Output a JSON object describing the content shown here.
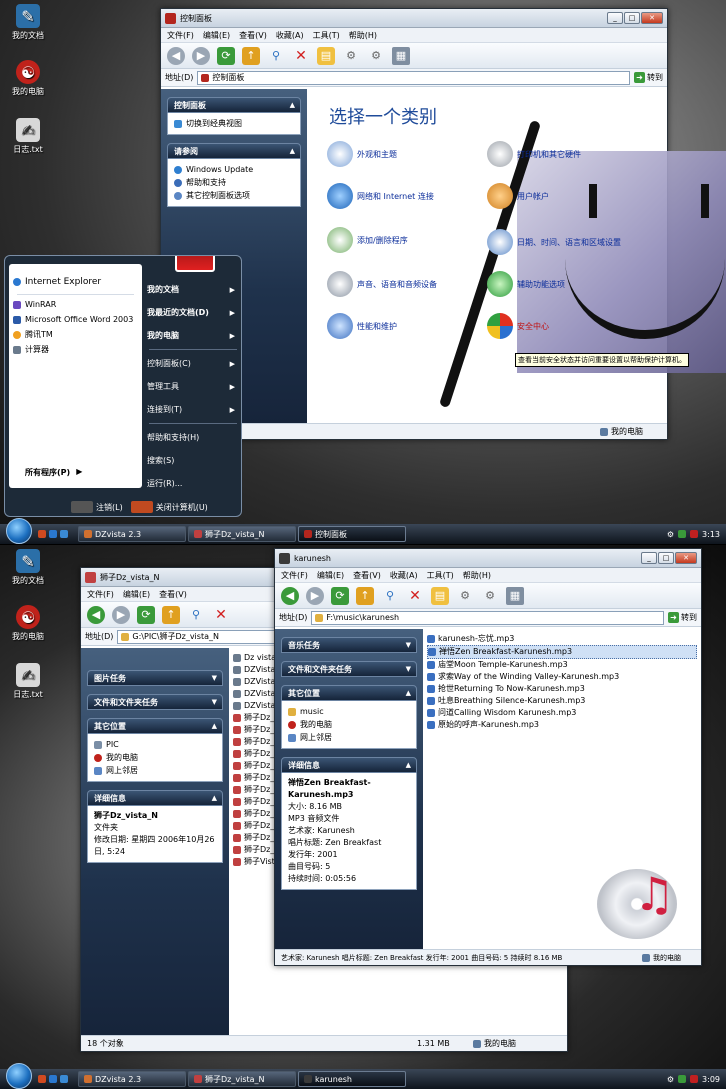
{
  "desktop_icons": [
    "我的文档",
    "我的电脑",
    "日志.txt"
  ],
  "control_panel": {
    "title": "控制面板",
    "menu": [
      "文件(F)",
      "编辑(E)",
      "查看(V)",
      "收藏(A)",
      "工具(T)",
      "帮助(H)"
    ],
    "address_label": "地址(D)",
    "address": "控制面板",
    "go": "转到",
    "side_panel_title": "控制面板",
    "switch_view": "切换到经典视图",
    "see_also_title": "请参阅",
    "see_also": [
      "Windows Update",
      "帮助和支持",
      "其它控制面板选项"
    ],
    "heading": "选择一个类别",
    "categories": [
      "外观和主题",
      "打印机和其它硬件",
      "网络和 Internet 连接",
      "用户帐户",
      "添加/删除程序",
      "日期、时间、语言和区域设置",
      "声音、语音和音频设备",
      "辅助功能选项",
      "性能和维护",
      "安全中心"
    ],
    "tooltip": "查看当前安全状态并访问重要设置以帮助保护计算机。",
    "status": "我的电脑"
  },
  "start_menu": {
    "pinned": [
      "Internet Explorer",
      "WinRAR",
      "Microsoft Office Word 2003",
      "腾讯TM",
      "计算器"
    ],
    "all_programs": "所有程序(P)",
    "right": [
      "我的文档",
      "我最近的文档(D)",
      "我的电脑",
      "控制面板(C)",
      "管理工具",
      "连接到(T)",
      "帮助和支持(H)",
      "搜索(S)",
      "运行(R)..."
    ],
    "logoff": "注销(L)",
    "shutdown": "关闭计算机(U)"
  },
  "taskbar1": {
    "items": [
      "DZvista 2.3",
      "狮子Dz_vista_N",
      "控制面板"
    ],
    "clock": "3:13"
  },
  "win_dz": {
    "title": "狮子Dz_vista_N",
    "address_label": "地址(D)",
    "address": "G:\\PIC\\狮子Dz_vista_N",
    "panels": [
      "图片任务",
      "文件和文件夹任务",
      "其它位置",
      "详细信息"
    ],
    "other_places": [
      "PIC",
      "我的电脑",
      "网上邻居"
    ],
    "details": {
      "name": "狮子Dz_vista_N",
      "type": "文件夹",
      "modified": "修改日期: 星期四 2006年10月26日, 5:24"
    },
    "files": [
      "Dz vista",
      "DZVista2",
      "DZVista2",
      "DZVista2",
      "DZVista2",
      "狮子Dz_",
      "狮子Dz_",
      "狮子Dz_",
      "狮子Dz_",
      "狮子Dz_",
      "狮子Dz_",
      "狮子Dz_",
      "狮子Dz_",
      "狮子Dz_",
      "狮子Dz_",
      "狮子Dz_",
      "狮子Dz_",
      "狮子Vist"
    ],
    "status_count": "18 个对象",
    "status_size": "1.31 MB",
    "status_loc": "我的电脑"
  },
  "win_k": {
    "title": "karunesh",
    "menu": [
      "文件(F)",
      "编辑(E)",
      "查看(V)",
      "收藏(A)",
      "工具(T)",
      "帮助(H)"
    ],
    "address_label": "地址(D)",
    "address": "F:\\music\\karunesh",
    "go": "转到",
    "panels": [
      "音乐任务",
      "文件和文件夹任务",
      "其它位置",
      "详细信息"
    ],
    "other_places": [
      "music",
      "我的电脑",
      "网上邻居"
    ],
    "details": {
      "name": "禅悟Zen Breakfast-Karunesh.mp3",
      "size": "大小: 8.16 MB",
      "type": "MP3 音频文件",
      "artist": "艺术家: Karunesh",
      "album": "唱片标题: Zen Breakfast",
      "year": "发行年: 2001",
      "track": "曲目号码: 5",
      "duration": "持续时间: 0:05:56"
    },
    "files": [
      "karunesh-忘忧.mp3",
      "禅悟Zen Breakfast-Karunesh.mp3",
      "庙堂Moon Temple-Karunesh.mp3",
      "求索Way of the Winding Valley-Karunesh.mp3",
      "抢世Returning To Now-Karunesh.mp3",
      "吐息Breathing Silence-Karunesh.mp3",
      "问道Calling Wisdom Karunesh.mp3",
      "原始的呼声-Karunesh.mp3"
    ],
    "status": "艺术家: Karunesh 唱片标题: Zen Breakfast 发行年: 2001 曲目号码: 5 持续时 8.16 MB",
    "status_loc": "我的电脑"
  },
  "taskbar2": {
    "items": [
      "DZvista 2.3",
      "狮子Dz_vista_N",
      "karunesh"
    ],
    "clock": "3:09"
  }
}
